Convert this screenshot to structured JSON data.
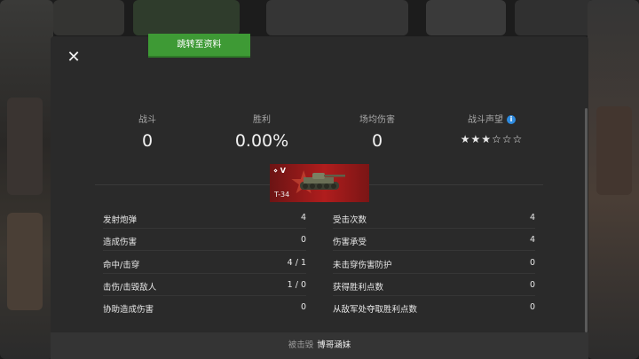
{
  "header": {
    "close_label": "✕",
    "goto_profile_label": "跳转至资料"
  },
  "stats": [
    {
      "label": "战斗",
      "value": "0"
    },
    {
      "label": "胜利",
      "value": "0.00%"
    },
    {
      "label": "场均伤害",
      "value": "0"
    },
    {
      "label": "战斗声望",
      "stars_filled": 3,
      "stars_total": 6,
      "stars_text": "★★★☆☆☆"
    }
  ],
  "tank": {
    "tier": "V",
    "name": "T-34",
    "icon": "tank-icon"
  },
  "left_column": [
    {
      "label": "发射炮弹",
      "value": "4"
    },
    {
      "label": "造成伤害",
      "value": "0"
    },
    {
      "label": "命中/击穿",
      "value": "4 / 1"
    },
    {
      "label": "击伤/击毁敌人",
      "value": "1 / 0"
    },
    {
      "label": "协助造成伤害",
      "value": "0"
    }
  ],
  "right_column": [
    {
      "label": "受击次数",
      "value": "4"
    },
    {
      "label": "伤害承受",
      "value": "4"
    },
    {
      "label": "未击穿伤害防护",
      "value": "0"
    },
    {
      "label": "获得胜利点数",
      "value": "0"
    },
    {
      "label": "从敌军处夺取胜利点数",
      "value": "0"
    }
  ],
  "footer": {
    "destroyed_by_label": "被击毁",
    "killer_name": "博哥涵妹"
  },
  "colors": {
    "accent_green": "#3e9a35",
    "info_blue": "#2e8be0",
    "tank_card_red": "#b01d1d"
  }
}
